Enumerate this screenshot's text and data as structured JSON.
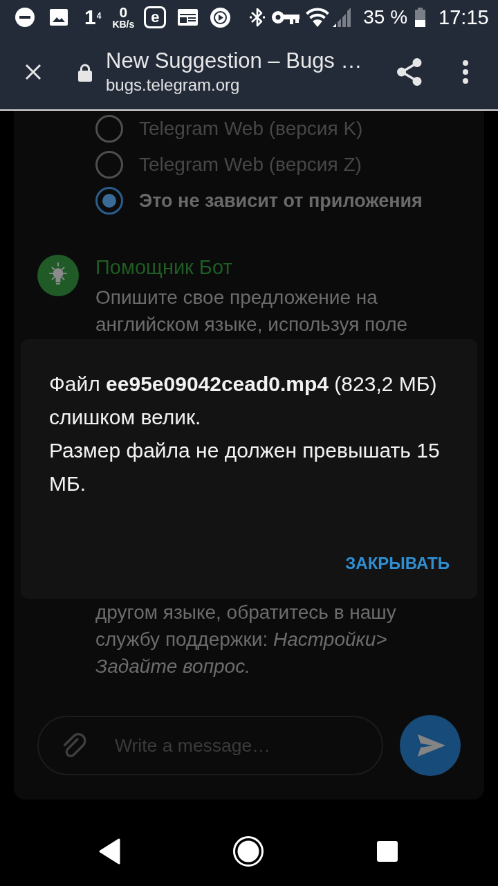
{
  "status_bar": {
    "indicator": "1$^{4}$",
    "net_speed": "0",
    "net_speed_unit": "KB/s",
    "app_letter": "e",
    "battery": "35 %",
    "time": "17:15"
  },
  "browser_bar": {
    "title": "New Suggestion – Bugs …",
    "url": "bugs.telegram.org"
  },
  "radio_options": [
    {
      "label": "Telegram Web (версия K)",
      "selected": false
    },
    {
      "label": "Telegram Web (версия Z)",
      "selected": false
    },
    {
      "label": "Это не зависит от приложения",
      "selected": true
    }
  ],
  "bot_message": {
    "sender": "Помощник Бот",
    "text_above": "Опишите свое предложение на английском языке, используя поле",
    "text_below": "другом языке, обратитесь в нашу службу поддержки: *Настройки> Задайте вопрос.*"
  },
  "dialog": {
    "paragraphs": [
      "Файл **ee95e09042cead0.mp4** (823,2 МБ) слишком велик.",
      "Размер файла не должен превышать 15 МБ."
    ],
    "button": "ЗАКРЫВАТЬ"
  },
  "composer": {
    "placeholder": "Write a message…"
  }
}
